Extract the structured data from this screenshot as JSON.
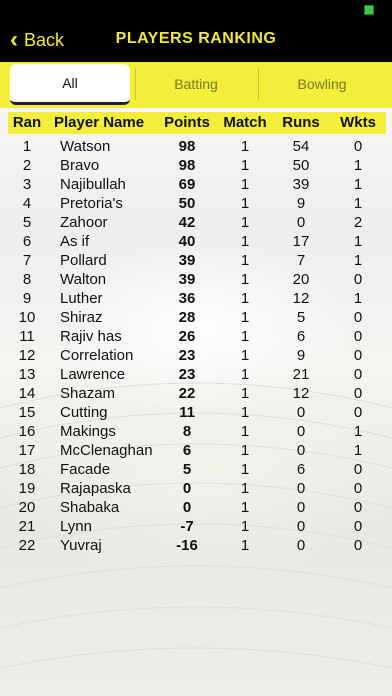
{
  "header": {
    "back_label": "Back",
    "title": "PLAYERS RANKING"
  },
  "tabs": [
    {
      "label": "All",
      "active": true
    },
    {
      "label": "Batting",
      "active": false
    },
    {
      "label": "Bowling",
      "active": false
    }
  ],
  "table": {
    "columns": [
      "Ran",
      "Player Name",
      "Points",
      "Match",
      "Runs",
      "Wkts"
    ],
    "rows": [
      {
        "rank": "1",
        "name": "Watson",
        "points": "98",
        "match": "1",
        "runs": "54",
        "wkts": "0"
      },
      {
        "rank": "2",
        "name": "Bravo",
        "points": "98",
        "match": "1",
        "runs": "50",
        "wkts": "1"
      },
      {
        "rank": "3",
        "name": "Najibullah",
        "points": "69",
        "match": "1",
        "runs": "39",
        "wkts": "1"
      },
      {
        "rank": "4",
        "name": "Pretoria's",
        "points": "50",
        "match": "1",
        "runs": "9",
        "wkts": "1"
      },
      {
        "rank": "5",
        "name": "Zahoor",
        "points": "42",
        "match": "1",
        "runs": "0",
        "wkts": "2"
      },
      {
        "rank": "6",
        "name": "As if",
        "points": "40",
        "match": "1",
        "runs": "17",
        "wkts": "1"
      },
      {
        "rank": "7",
        "name": "Pollard",
        "points": "39",
        "match": "1",
        "runs": "7",
        "wkts": "1"
      },
      {
        "rank": "8",
        "name": "Walton",
        "points": "39",
        "match": "1",
        "runs": "20",
        "wkts": "0"
      },
      {
        "rank": "9",
        "name": "Luther",
        "points": "36",
        "match": "1",
        "runs": "12",
        "wkts": "1"
      },
      {
        "rank": "10",
        "name": "Shiraz",
        "points": "28",
        "match": "1",
        "runs": "5",
        "wkts": "0"
      },
      {
        "rank": "11",
        "name": "Rajiv has",
        "points": "26",
        "match": "1",
        "runs": "6",
        "wkts": "0"
      },
      {
        "rank": "12",
        "name": "Correlation",
        "points": "23",
        "match": "1",
        "runs": "9",
        "wkts": "0"
      },
      {
        "rank": "13",
        "name": "Lawrence",
        "points": "23",
        "match": "1",
        "runs": "21",
        "wkts": "0"
      },
      {
        "rank": "14",
        "name": "Shazam",
        "points": "22",
        "match": "1",
        "runs": "12",
        "wkts": "0"
      },
      {
        "rank": "15",
        "name": "Cutting",
        "points": "11",
        "match": "1",
        "runs": "0",
        "wkts": "0"
      },
      {
        "rank": "16",
        "name": "Makings",
        "points": "8",
        "match": "1",
        "runs": "0",
        "wkts": "1"
      },
      {
        "rank": "17",
        "name": "McClenaghan",
        "points": "6",
        "match": "1",
        "runs": "0",
        "wkts": "1"
      },
      {
        "rank": "18",
        "name": "Facade",
        "points": "5",
        "match": "1",
        "runs": "6",
        "wkts": "0"
      },
      {
        "rank": "19",
        "name": "Rajapaska",
        "points": "0",
        "match": "1",
        "runs": "0",
        "wkts": "0"
      },
      {
        "rank": "20",
        "name": "Shabaka",
        "points": "0",
        "match": "1",
        "runs": "0",
        "wkts": "0"
      },
      {
        "rank": "21",
        "name": "Lynn",
        "points": "-7",
        "match": "1",
        "runs": "0",
        "wkts": "0"
      },
      {
        "rank": "22",
        "name": "Yuvraj",
        "points": "-16",
        "match": "1",
        "runs": "0",
        "wkts": "0"
      }
    ]
  },
  "colors": {
    "accent_yellow": "#f3ee3a",
    "header_black": "#000000",
    "title_yellow": "#f2e935"
  },
  "icons": {
    "back": "chevron-left-icon",
    "battery": "battery-icon"
  }
}
